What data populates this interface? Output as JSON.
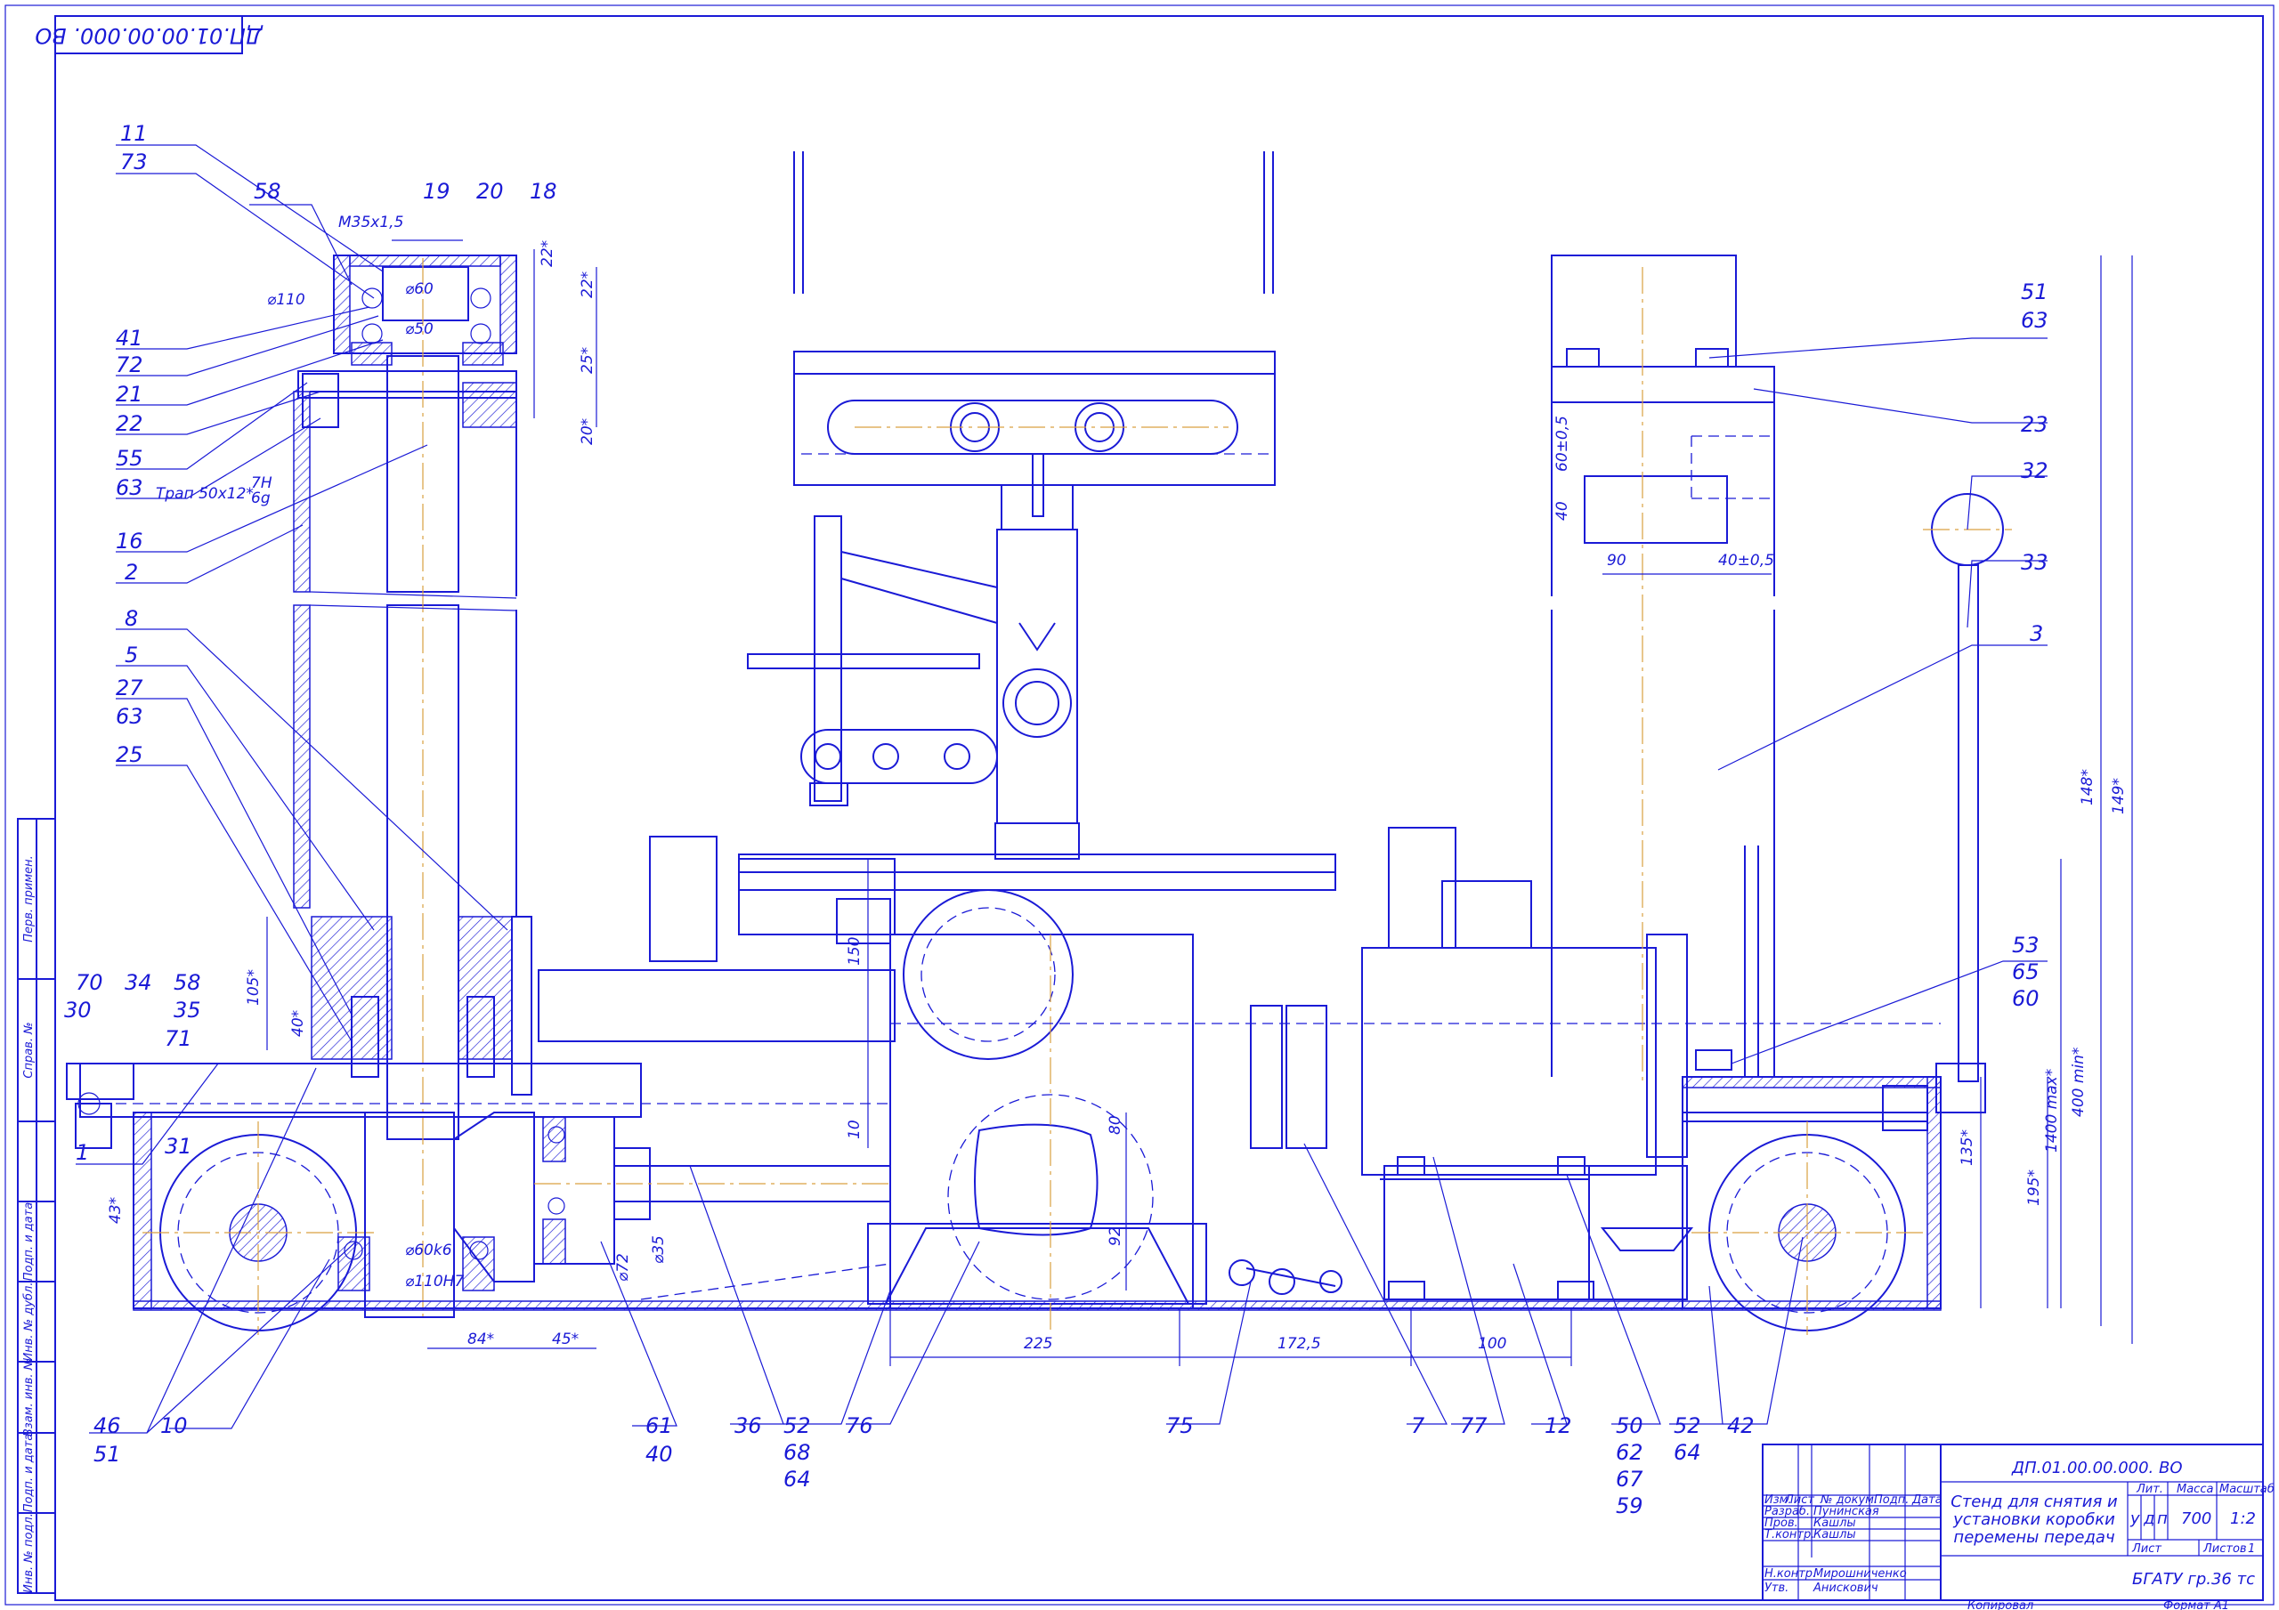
{
  "designation_rotated": "ДП.01.00.00.000. ВО",
  "callouts_left": [
    "11",
    "73",
    "58",
    "19",
    "20",
    "18",
    "41",
    "72",
    "21",
    "22",
    "55",
    "63",
    "16",
    "2",
    "8",
    "5",
    "27",
    "63",
    "25",
    "70",
    "34",
    "58",
    "30",
    "35",
    "71",
    "31",
    "1",
    "46",
    "51",
    "10"
  ],
  "callouts_bottom": [
    "61",
    "40",
    "36",
    "52",
    "68",
    "64",
    "76",
    "75",
    "7",
    "77",
    "12",
    "50",
    "62",
    "67",
    "59",
    "52",
    "64",
    "42"
  ],
  "callouts_right": [
    "51",
    "63",
    "23",
    "32",
    "33",
    "3",
    "53",
    "65",
    "60"
  ],
  "dims": {
    "m35": "М35х1,5",
    "d110": "⌀110",
    "d60": "⌀60",
    "d50": "⌀50",
    "a22a": "22*",
    "a22b": "22*",
    "a25": "25*",
    "a20": "20*",
    "trap": "Трап 50х12*",
    "trap_fit_top": "7H",
    "trap_fit_bot": "6g",
    "d60k6": "⌀60k6",
    "d110h7": "⌀110H7",
    "d72": "⌀72",
    "d35": "⌀35",
    "d84": "84*",
    "d45": "45*",
    "d105": "105*",
    "d40": "40*",
    "d43": "43*",
    "d150": "150",
    "d10": "10",
    "d80": "80",
    "d92": "92",
    "d225": "225",
    "d172": "172,5",
    "d100": "100",
    "d600": "60±0,5",
    "d40v": "40",
    "d90": "90",
    "d400": "40±0,5",
    "d1400": "1400 max*",
    "d400min": "400 min*",
    "d135": "135*",
    "d195": "195*",
    "d148": "148*",
    "d149": "149*"
  },
  "title_block": {
    "designation": "ДП.01.00.00.000. ВО",
    "name_line1": "Стенд для снятия и",
    "name_line2": "установки коробки",
    "name_line3": "перемены передач",
    "col_lit": "Лит.",
    "col_mass": "Масса",
    "col_scale": "Масштаб",
    "lit1": "у",
    "lit2": "д",
    "lit3": "п",
    "mass": "700",
    "scale": "1:2",
    "sheet_label": "Лист",
    "sheets_label": "Листов",
    "sheets_value": "1",
    "org": "БГАТУ гр.36 тс",
    "h_izm": "Изм.",
    "h_list": "Лист",
    "h_doc": "№ докум.",
    "h_sign": "Подп.",
    "h_date": "Дата",
    "r1_role": "Разраб.",
    "r1_name": "Пунинская",
    "r2_role": "Пров.",
    "r2_name": "Кашлы",
    "r3_role": "Т.контр.",
    "r3_name": "Кашлы",
    "r4_role": "Н.контр.",
    "r4_name": "Мирошниченко",
    "r5_role": "Утв.",
    "r5_name": "Анискович",
    "copied": "Копировал",
    "format": "Формат   А1"
  },
  "side_strip": [
    "Перв. примен.",
    "Справ. №",
    "Подп. и дата",
    "Инв. № дубл.",
    "Взам. инв. №",
    "Подп. и дата",
    "Инв. № подл."
  ]
}
